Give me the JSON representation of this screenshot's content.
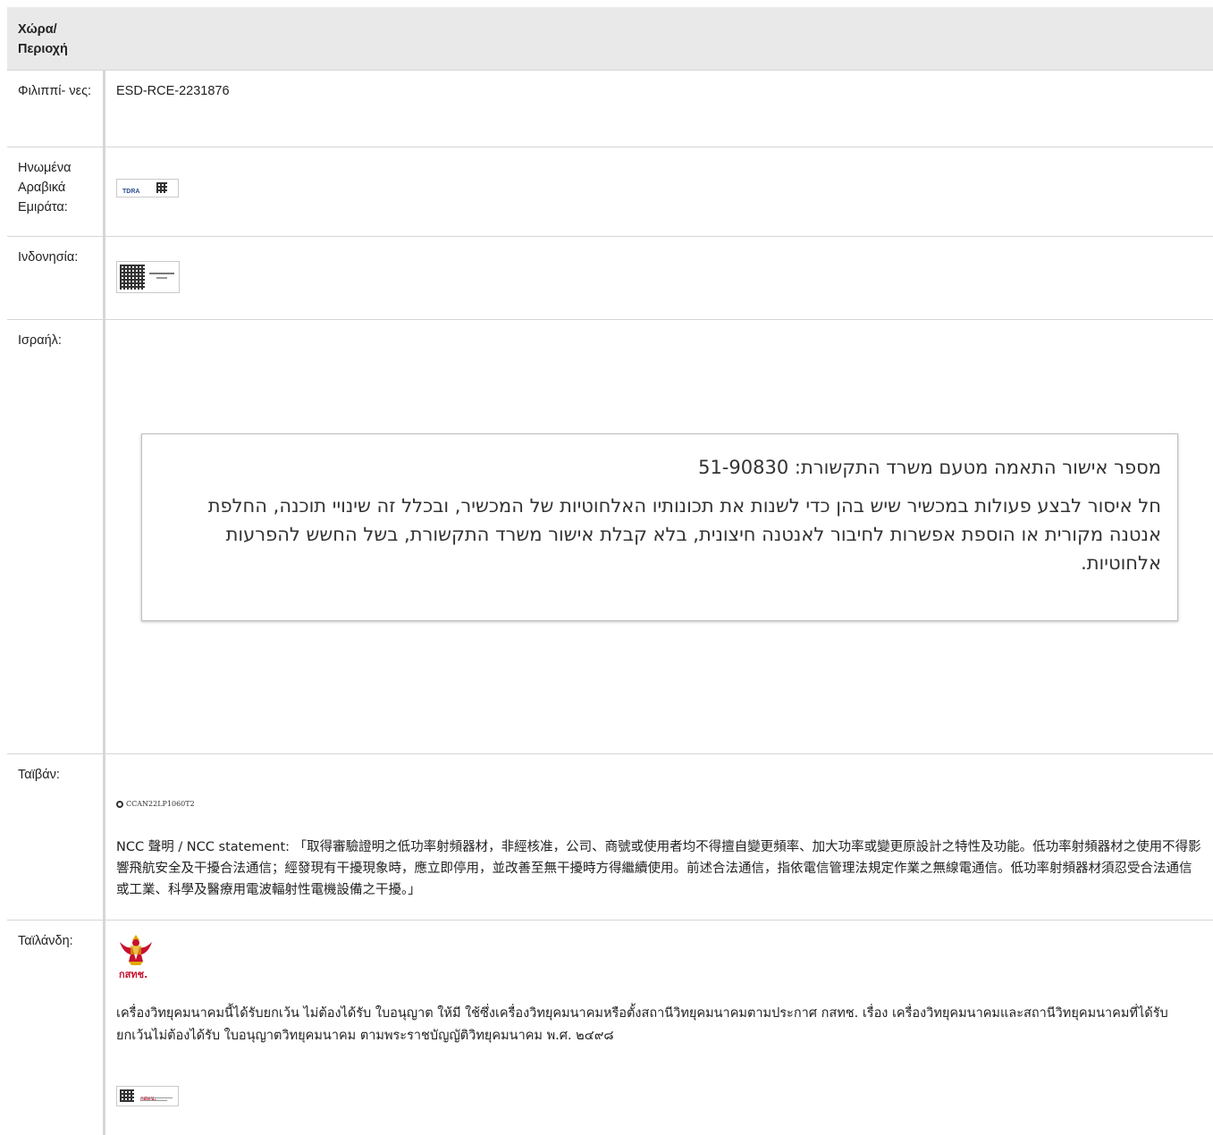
{
  "header": {
    "country_label": "Χώρα/ Περιοχή"
  },
  "rows": [
    {
      "country": "Φιλιππί- νες:",
      "value": "ESD-RCE-2231876"
    },
    {
      "country": "Ηνωμένα Αραβικά Εμιράτα:",
      "cert_text": "TDRA"
    },
    {
      "country": "Ινδονησία:"
    },
    {
      "country": "Ισραήλ:",
      "line1": "מספר אישור התאמה מטעם משרד התקשורת: 51-90830",
      "line2": "חל איסור לבצע פעולות במכשיר שיש בהן כדי לשנות את תכונותיו האלחוטיות של המכשיר, ובכלל זה שינויי תוכנה, החלפת אנטנה מקורית או הוספת אפשרות לחיבור לאנטנה חיצונית, בלא קבלת אישור משרד התקשורת, בשל החשש להפרעות אלחוטיות."
    },
    {
      "country": "Ταϊβάν:",
      "ncc_code": "CCAN22LP1060T2",
      "statement": "NCC 聲明 / NCC statement: 「取得審驗證明之低功率射頻器材，非經核准，公司、商號或使用者均不得擅自變更頻率、加大功率或變更原設計之特性及功能。低功率射頻器材之使用不得影響飛航安全及干擾合法通信；經發現有干擾現象時，應立即停用，並改善至無干擾時方得繼續使用。前述合法通信，指依電信管理法規定作業之無線電通信。低功率射頻器材須忍受合法通信或工業、科學及醫療用電波輻射性電機設備之干擾。」"
    },
    {
      "country": "Ταϊλάνδη:",
      "logo_caption": "กสทช.",
      "statement": "เครื่องวิทยุคมนาคมนี้ได้รับยกเว้น ไม่ต้องได้รับ ใบอนุญาต ให้มี ใช้ซึ่งเครื่องวิทยุคมนาคมหรือตั้งสถานีวิทยุคมนาคมตามประกาศ กสทช. เรื่อง เครื่องวิทยุคมนาคมและสถานีวิทยุคมนาคมที่ได้รับยกเว้นไม่ต้องได้รับ ใบอนุญาตวิทยุคมนาคม ตามพระราชบัญญัติวิทยุคมนาคม พ.ศ. ๒๔๙๘",
      "label_text": "กสทช."
    }
  ],
  "colors": {
    "header_bg": "#e9e9e9",
    "border": "#d6d6d6",
    "thai_red": "#c8102e",
    "thai_gold": "#e0a800"
  }
}
